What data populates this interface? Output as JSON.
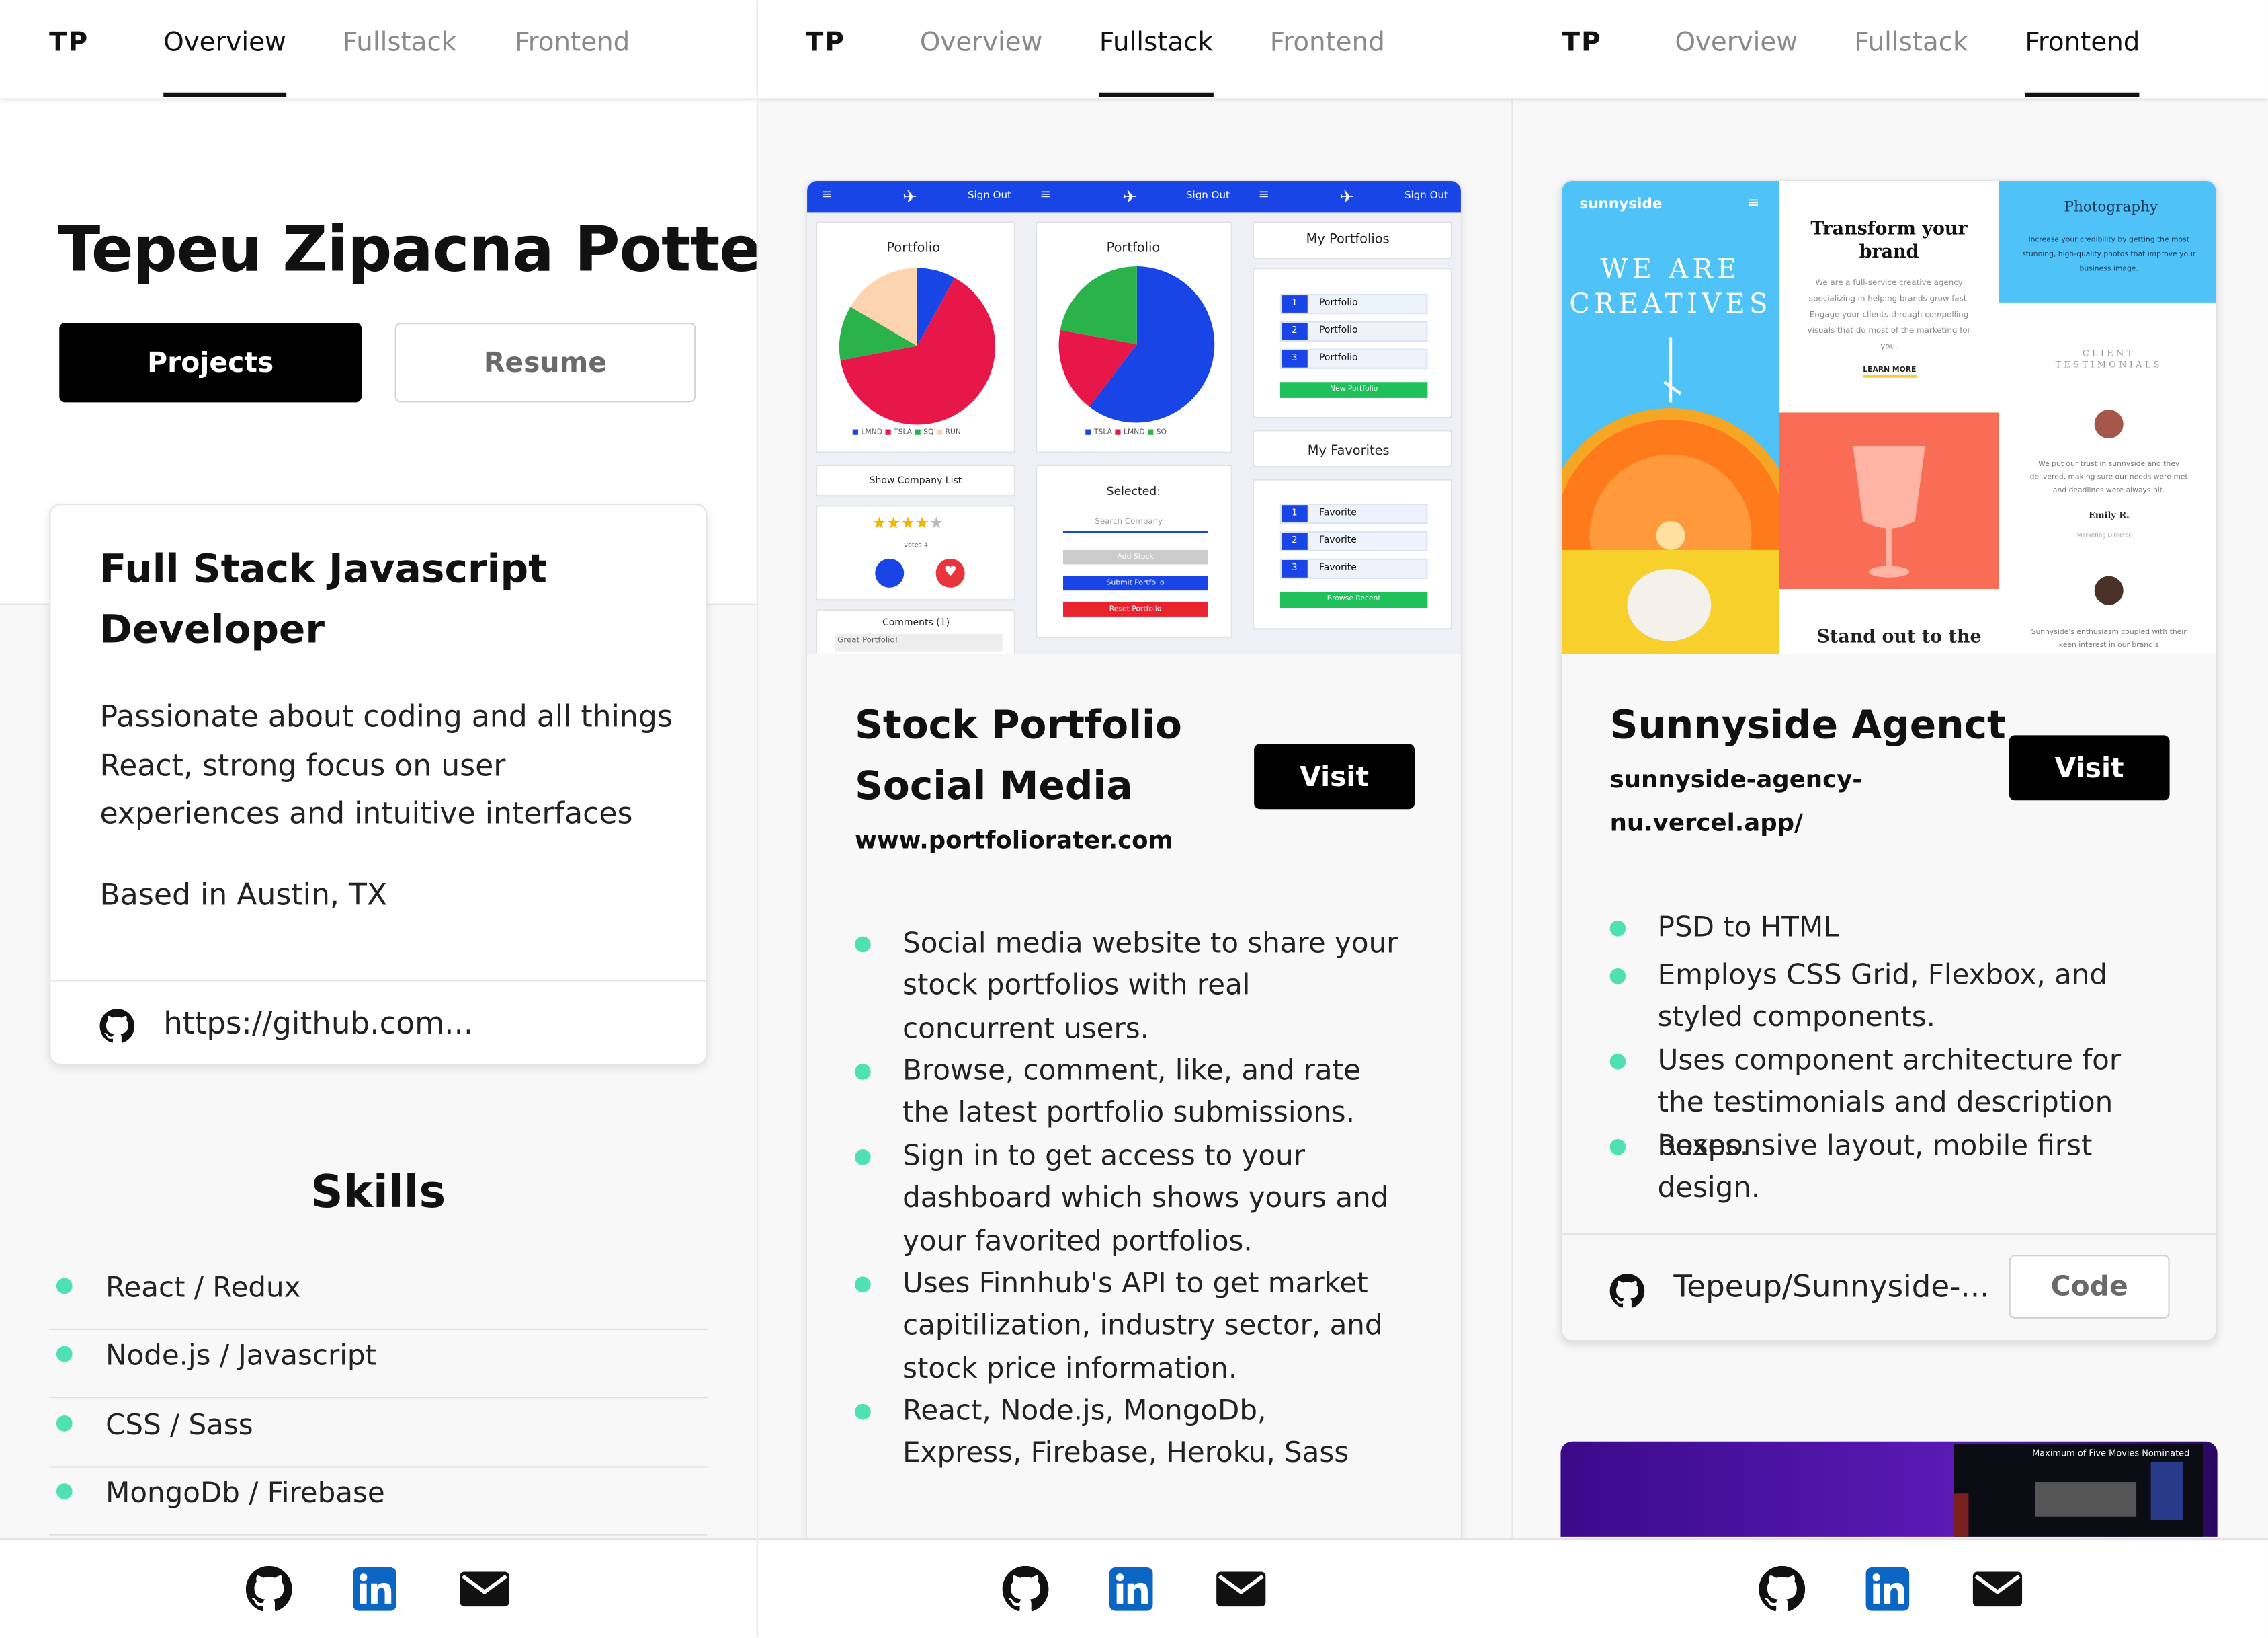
{
  "nav": {
    "logo": "TP",
    "tabs": [
      "Overview",
      "Fullstack",
      "Frontend"
    ]
  },
  "overview": {
    "name": "Tepeu Zipacna Potter",
    "projects_button": "Projects",
    "resume_button": "Resume",
    "card": {
      "title": "Full Stack Javascript Developer",
      "description": "Passionate about coding and all things React, strong focus on user experiences and intuitive interfaces",
      "location": "Based in Austin, TX",
      "github": "https://github.com..."
    },
    "skills_title": "Skills",
    "skills": [
      "React / Redux",
      "Node.js / Javascript",
      "CSS / Sass",
      "MongoDb / Firebase"
    ]
  },
  "fullstack": {
    "screenshot": {
      "sign_out": "Sign Out",
      "portfolio_title": "Portfolio",
      "legend_1": [
        "LMND",
        "TSLA",
        "SQ",
        "RUN"
      ],
      "legend_2": [
        "TSLA",
        "LMND",
        "SQ"
      ],
      "show_company": "Show Company List",
      "votes": "votes 4",
      "comments": "Comments (1)",
      "comment_text": "Great Portfolio!",
      "selected": "Selected:",
      "search_company": "Search Company",
      "add_stock": "Add Stock",
      "submit_portfolio": "Submit Portfolio",
      "reset_portfolio": "Reset Portfolio",
      "my_portfolios": "My Portfolios",
      "portfolio_item": "Portfolio",
      "new_portfolio": "New Portfolio",
      "my_favorites": "My Favorites",
      "favorite_item": "Favorite",
      "browse_recent": "Browse Recent",
      "nums": [
        "1",
        "2",
        "3"
      ]
    },
    "title": "Stock Portfolio Social Media",
    "url": "www.portfoliorater.com",
    "visit": "Visit",
    "bullets": [
      "Social media website to share your stock portfolios with real concurrent users.",
      "Browse, comment, like, and rate the latest portfolio submissions.",
      "Sign in to get access to your dashboard which shows yours and your favorited portfolios.",
      "Uses Finnhub's API to get market capitilization, industry sector, and stock price information.",
      "React, Node.js, MongoDb, Express, Firebase, Heroku, Sass"
    ]
  },
  "frontend": {
    "screenshot": {
      "brand": "sunnyside",
      "hero": "WE ARE CREATIVES",
      "transform_title": "Transform your brand",
      "transform_text": "We are a full-service creative agency specializing in helping brands grow fast. Engage your clients through compelling visuals that do most of the marketing for you.",
      "learn_more": "LEARN MORE",
      "photo_title": "Photography",
      "photo_text": "Increase your credibility by getting the most stunning, high-quality photos that improve your business image.",
      "testimonials": "CLIENT TESTIMONIALS",
      "testimonial_text": "We put our trust in sunnyside and they delivered, making sure our needs were met and deadlines were always hit.",
      "person_name": "Emily R.",
      "person_role": "Marketing Director",
      "stand_out": "Stand out to the",
      "testimonial_2": "Sunnyside's enthusiasm coupled with their keen interest in our brand's",
      "movies_banner": "Maximum of Five Movies Nominated"
    },
    "title": "Sunnyside Agenct",
    "url": "sunnyside-agency-nu.vercel.app/",
    "visit": "Visit",
    "bullets": [
      "PSD to HTML",
      "Employs CSS Grid, Flexbox, and styled components.",
      "Uses component architecture for the testimonials and description boxes.",
      "Responsive layout, mobile first design."
    ],
    "repo": "Tepeup/Sunnyside-...",
    "code_button": "Code"
  },
  "colors": {
    "accent_dot": "#4fe0b4",
    "nav_blue": "#1a45e6",
    "sky": "#4fc3f7"
  }
}
